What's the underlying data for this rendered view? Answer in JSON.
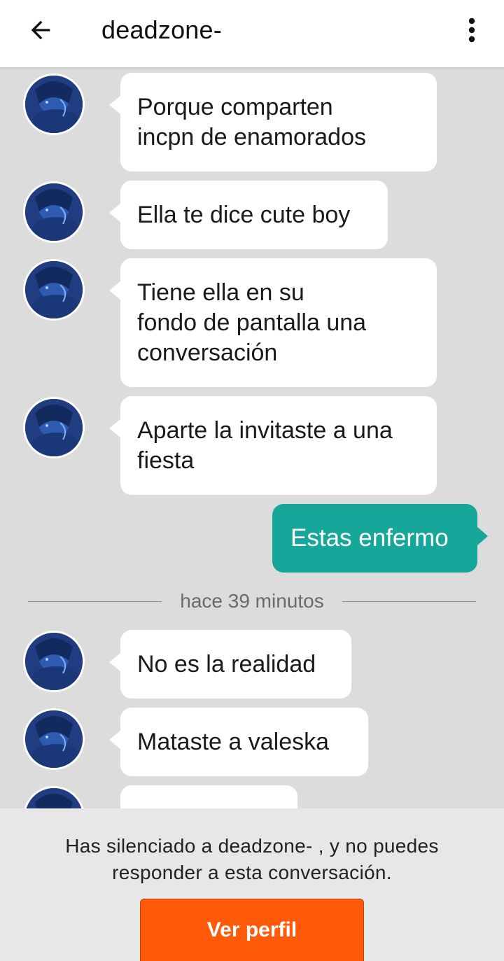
{
  "header": {
    "title": "deadzone-",
    "back_icon": "arrow-left-icon",
    "menu_icon": "more-vert-icon"
  },
  "messages": [
    {
      "direction": "in",
      "text": "Porque comparten\nincpn de enamorados"
    },
    {
      "direction": "in",
      "text": "Ella te dice cute boy"
    },
    {
      "direction": "in",
      "text": "Tiene ella en su\nfondo de pantalla una\nconversación"
    },
    {
      "direction": "in",
      "text": "Aparte la invitaste a una\nfiesta"
    },
    {
      "direction": "out",
      "text": "Estas enfermo"
    },
    {
      "direction": "in",
      "text": "No es la realidad"
    },
    {
      "direction": "in",
      "text": "Mataste a valeska"
    },
    {
      "direction": "in",
      "text": ""
    }
  ],
  "divider": {
    "label": "hace 39 minutos"
  },
  "footer": {
    "notice": "Has silenciado a deadzone- , y no puedes responder a esta conversación.",
    "button_label": "Ver perfil"
  },
  "colors": {
    "background": "#dcdcdc",
    "outgoing_bubble": "#17a79a",
    "button": "#ff5a0a"
  }
}
